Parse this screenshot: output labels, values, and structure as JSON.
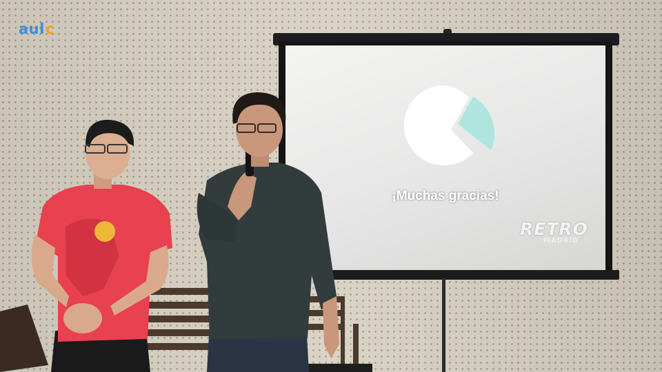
{
  "watermark": {
    "logo_text": "aul",
    "logo_accent": "c",
    "colors": {
      "blue": "#3c8fd9",
      "orange": "#f2a21b"
    }
  },
  "slide": {
    "thanks_text": "¡Muchas gracias!",
    "event_logo": "RETRO",
    "event_sub": "MADRID",
    "logo_colors": {
      "circle": "#ffffff",
      "wedge": "#aee6df"
    }
  },
  "scene": {
    "icons": [
      "projector-screen",
      "microphone",
      "chair"
    ],
    "colors": {
      "left_shirt": "#e8414f",
      "right_shirt": "#323c3c",
      "wall": "#d8d1c3"
    }
  }
}
